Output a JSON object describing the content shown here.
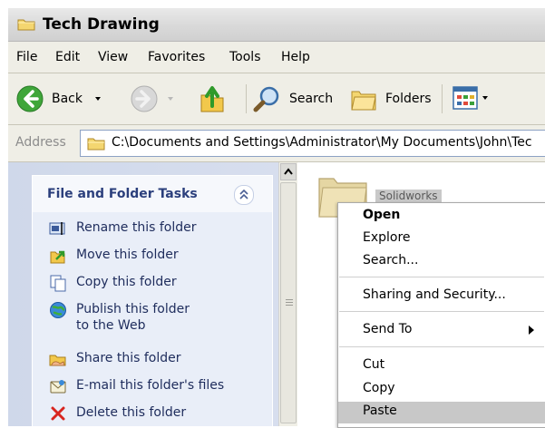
{
  "window": {
    "title": "Tech Drawing"
  },
  "menu": [
    "File",
    "Edit",
    "View",
    "Favorites",
    "Tools",
    "Help"
  ],
  "toolbar": {
    "back_label": "Back",
    "search_label": "Search",
    "folders_label": "Folders"
  },
  "address": {
    "label": "Address",
    "path": "C:\\Documents and Settings\\Administrator\\My Documents\\John\\Tec"
  },
  "tasks": {
    "title": "File and Folder Tasks",
    "items": [
      {
        "label": "Rename this folder",
        "icon": "rename-icon"
      },
      {
        "label": "Move this folder",
        "icon": "move-icon"
      },
      {
        "label": "Copy this folder",
        "icon": "copy-icon"
      },
      {
        "label": "Publish this folder to the Web",
        "icon": "publish-web-icon"
      },
      {
        "label": "Share this folder",
        "icon": "share-icon"
      },
      {
        "label": "E-mail this folder's files",
        "icon": "email-icon"
      },
      {
        "label": "Delete this folder",
        "icon": "delete-icon"
      }
    ]
  },
  "content": {
    "folder_name": "Solidworks"
  },
  "context_menu": {
    "items": [
      "Open",
      "Explore",
      "Search...",
      "Sharing and Security...",
      "Send To",
      "Cut",
      "Copy",
      "Paste"
    ],
    "highlighted": "Paste",
    "default": "Open"
  },
  "colors": {
    "task_link": "#1e2c5c",
    "panel_title": "#2b3f7c",
    "highlight": "#c8c8c8"
  }
}
